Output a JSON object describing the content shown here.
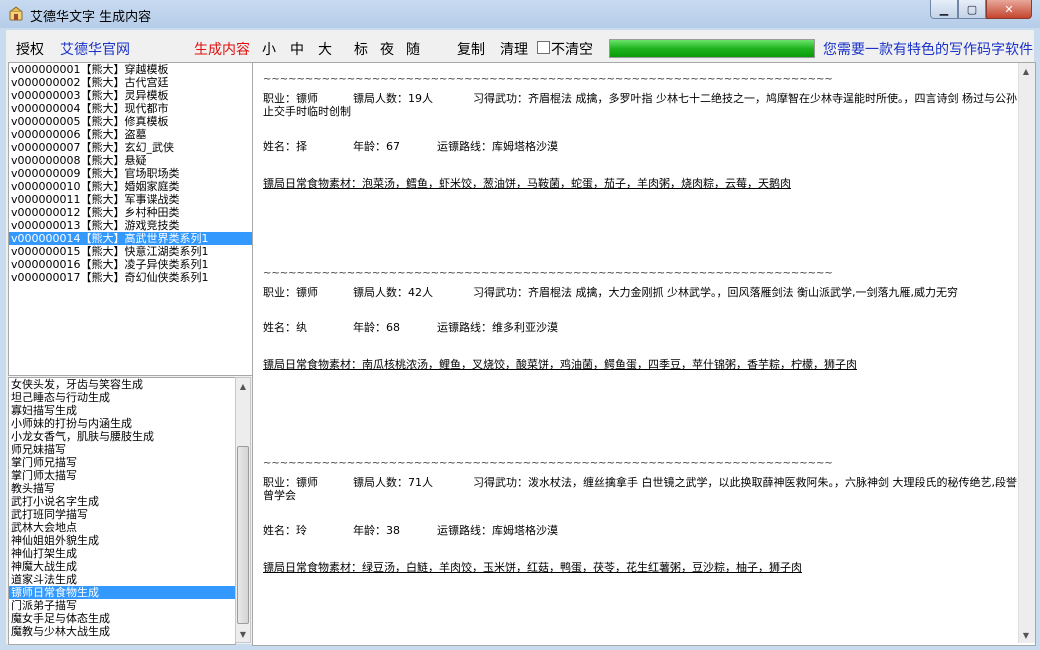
{
  "window": {
    "title": "艾德华文字 生成内容"
  },
  "toolbar": {
    "auth": "授权",
    "website": "艾德华官网",
    "generate": "生成内容",
    "small": "小",
    "medium": "中",
    "large": "大",
    "mark": "标",
    "night": "夜",
    "random": "随",
    "copy": "复制",
    "clear": "清理",
    "noclear": "不清空",
    "progress": 1.0,
    "promo": "您需要一款有特色的写作码字软件"
  },
  "templates": [
    "v000000001【熊大】穿越模板",
    "v000000002【熊大】古代宫廷",
    "v000000003【熊大】灵异模板",
    "v000000004【熊大】现代都市",
    "v000000005【熊大】修真模板",
    "v000000006【熊大】盗墓",
    "v000000007【熊大】玄幻_武侠",
    "v000000008【熊大】悬疑",
    "v000000009【熊大】官场职场类",
    "v000000010【熊大】婚姻家庭类",
    "v000000011【熊大】军事谍战类",
    "v000000012【熊大】乡村种田类",
    "v000000013【熊大】游戏竞技类",
    "v000000014【熊大】高武世界类系列1",
    "v000000015【熊大】快意江湖类系列1",
    "v000000016【熊大】凌子异侠类系列1",
    "v000000017【熊大】奇幻仙侠类系列1"
  ],
  "templates_selected": 13,
  "generators": [
    "女侠头发，牙齿与笑容生成",
    "坦己睡态与行动生成",
    "寡妇描写生成",
    "小师妹的打扮与内涵生成",
    "小龙女香气，肌肤与腰肢生成",
    "师兄妹描写",
    "掌门师兄描写",
    "掌门师太描写",
    "教头描写",
    "武打小说名字生成",
    "武打班同学描写",
    "武林大会地点",
    "神仙姐姐外貌生成",
    "神仙打架生成",
    "神魔大战生成",
    "道家斗法生成",
    "镖师日常食物生成",
    "门派弟子描写",
    "魔女手足与体态生成",
    "魔教与少林大战生成"
  ],
  "generators_selected": 16,
  "content": {
    "separator": "~~~~~~~~~~~~~~~~~~~~~~~~~~~~~~~~~~~~~~~~~~~~~~~~~~~~~~~~~~~~~~~~~~~~~~~~~~~~~~~~~~~~~~~~~~~~~~~~~~~~~~~~~~~~~~~~~~~~~~~~",
    "entries": [
      {
        "job": "职业：镖师",
        "count": "镖局人数：19人",
        "skill": "习得武功：齐眉棍法 成擒，多罗叶指 少林七十二绝技之一，鸠摩智在少林寺逞能时所使。，四言诗剑 杨过与公孙止交手时临时创制",
        "name": "姓名：择",
        "age": "年龄：67",
        "route": "运镖路线：库姆塔格沙漠",
        "foods": "镖局日常食物素材：泡菜汤，鳕鱼，虾米饺，葱油饼，马鞍菌，蛇蛋，茄子，羊肉粥，烧肉粽，云莓，天鹅肉"
      },
      {
        "job": "职业：镖师",
        "count": "镖局人数：42人",
        "skill": "习得武功：齐眉棍法 成擒，大力金刚抓 少林武学。，回风落雁剑法 衡山派武学,一剑落九雁,威力无穷",
        "name": "姓名：纨",
        "age": "年龄：68",
        "route": "运镖路线：维多利亚沙漠",
        "foods": "镖局日常食物素材：南瓜核桃浓汤，鲤鱼，叉烧饺，酸菜饼，鸡油菌，鳄鱼蛋，四季豆，苹什锦粥，香芋粽，柠檬，狮子肉"
      },
      {
        "job": "职业：镖师",
        "count": "镖局人数：71人",
        "skill": "习得武功：泼水杖法，缠丝擒拿手 白世镜之武学，以此换取薛神医救阿朱。，六脉神剑 大理段氏的秘传绝艺,段誉曾学会",
        "name": "姓名：玲",
        "age": "年龄：38",
        "route": "运镖路线：库姆塔格沙漠",
        "foods": "镖局日常食物素材：绿豆汤，白鲢，羊肉饺，玉米饼，红菇，鸭蛋，茯苓，花生红薯粥，豆沙粽，柚子，狮子肉"
      }
    ]
  }
}
